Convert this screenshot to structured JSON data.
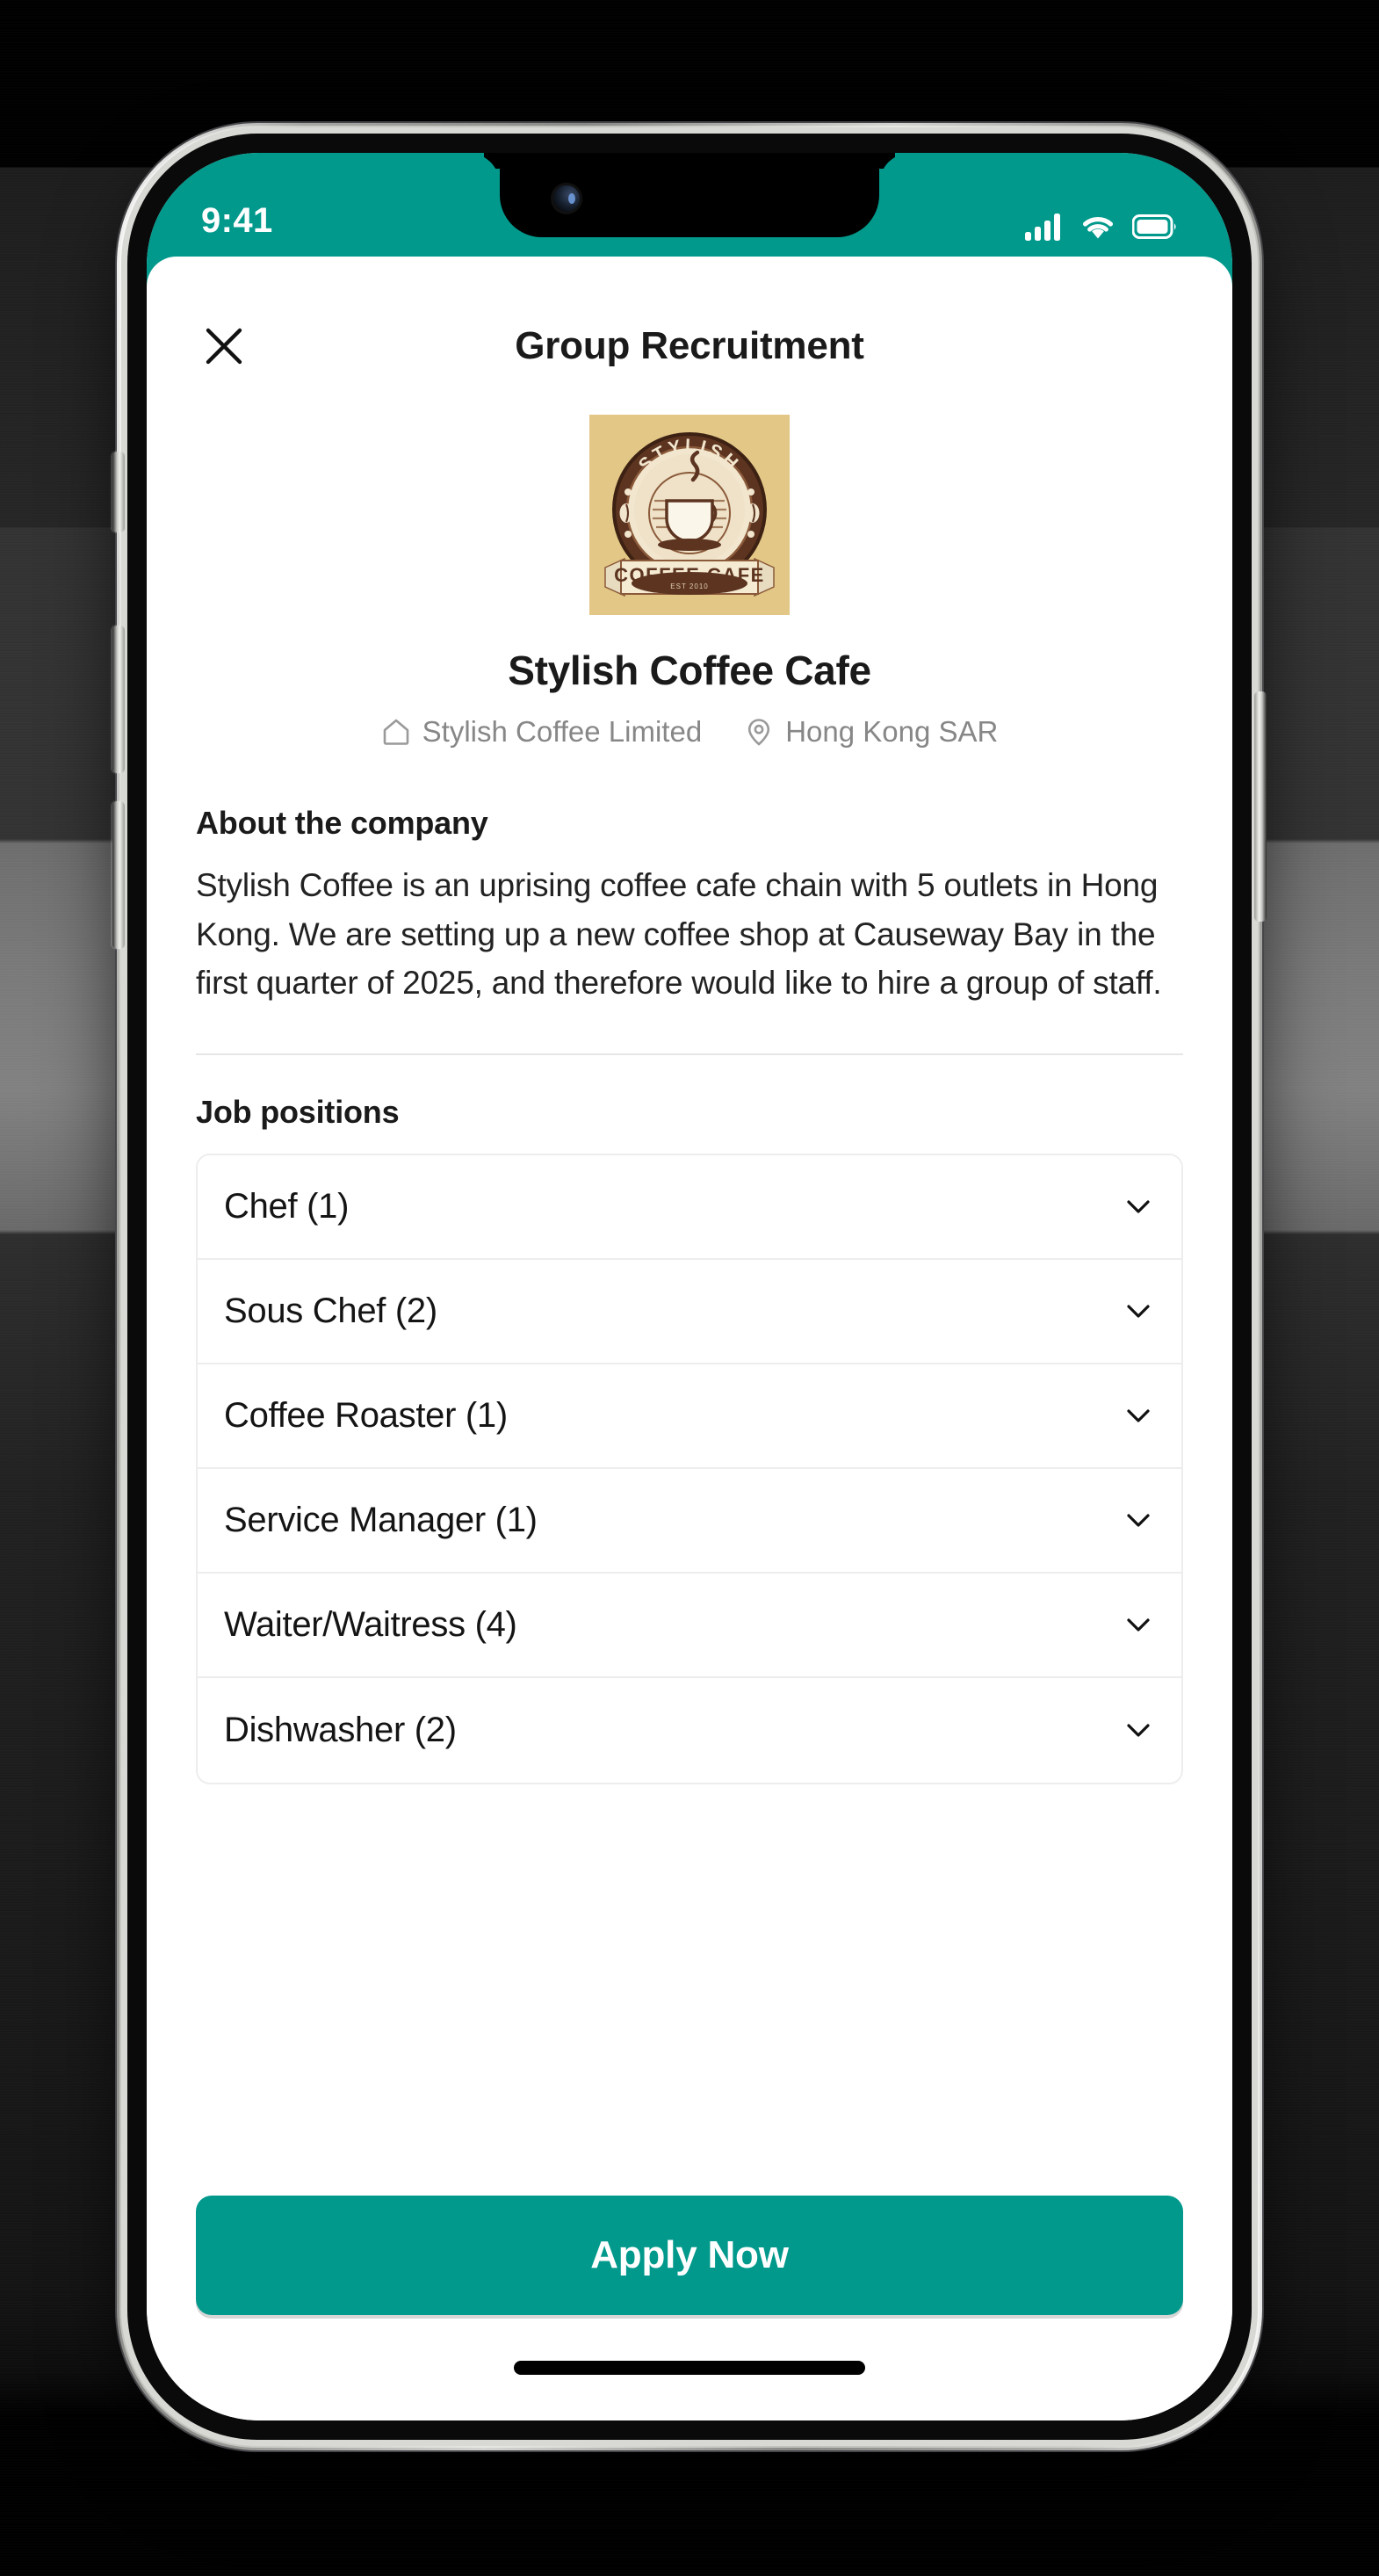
{
  "theme": {
    "accent_teal": "#00998c",
    "logo_background": "#e2c786",
    "text_primary": "#1a1a1a",
    "text_muted": "#878787",
    "divider": "#e6e6e6"
  },
  "status_bar": {
    "time": "9:41",
    "icons": [
      "cellular-signal-icon",
      "wifi-icon",
      "battery-icon"
    ],
    "signal_bars": 4,
    "wifi_strength": "full",
    "battery_level": "full"
  },
  "navbar": {
    "title": "Group Recruitment",
    "close_icon": "close-icon"
  },
  "company": {
    "logo_alt": "Stylish Coffee Cafe logo",
    "logo_text_top": "STYLISH",
    "logo_text_banner": "COFFEE CAFE",
    "logo_text_est": "EST 2010",
    "name": "Stylish Coffee Cafe",
    "legal_entity": "Stylish Coffee Limited",
    "legal_entity_icon": "home-icon",
    "location": "Hong Kong SAR",
    "location_icon": "location-pin-icon"
  },
  "about": {
    "heading": "About the company",
    "body": "Stylish Coffee is an uprising coffee cafe chain with 5 outlets in Hong Kong. We are setting up a new coffee shop at Causeway Bay in the first quarter of 2025, and therefore would like to hire a group of staff."
  },
  "jobs": {
    "heading": "Job positions",
    "expand_icon": "chevron-down-icon",
    "items": [
      {
        "label": "Chef (1)",
        "title": "Chef",
        "count": 1,
        "expanded": false
      },
      {
        "label": "Sous Chef (2)",
        "title": "Sous Chef",
        "count": 2,
        "expanded": false
      },
      {
        "label": "Coffee Roaster (1)",
        "title": "Coffee Roaster",
        "count": 1,
        "expanded": false
      },
      {
        "label": "Service Manager (1)",
        "title": "Service Manager",
        "count": 1,
        "expanded": false
      },
      {
        "label": "Waiter/Waitress (4)",
        "title": "Waiter/Waitress",
        "count": 4,
        "expanded": false
      },
      {
        "label": "Dishwasher (2)",
        "title": "Dishwasher",
        "count": 2,
        "expanded": false
      }
    ]
  },
  "cta": {
    "apply_label": "Apply Now"
  }
}
